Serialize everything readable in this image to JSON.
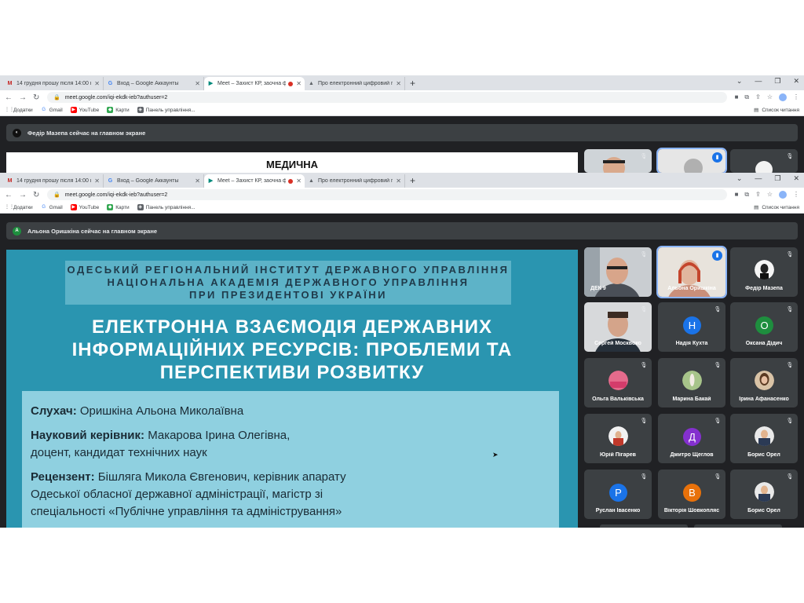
{
  "tabs": [
    {
      "title": "14 грудня прошу після 14:00 пі",
      "favicon_color": "#c5221f",
      "favicon_glyph": "M"
    },
    {
      "title": "Вход – Google Аккаунты",
      "favicon_color": "#4285f4",
      "favicon_glyph": "G"
    },
    {
      "title": "Meet – Захист КР, заочна ф",
      "favicon_color": "#00897b",
      "favicon_glyph": "▶"
    },
    {
      "title": "Про електронний цифровий пі",
      "favicon_color": "#5f6368",
      "favicon_glyph": "▲"
    }
  ],
  "url": "meet.google.com/iqi-ekdk-ieb?authuser=2",
  "bookmarks": [
    {
      "label": "Додатки",
      "icon": "apps-icon",
      "color": "#5f6368"
    },
    {
      "label": "Gmail",
      "icon": "gmail-icon",
      "color": "#4285f4"
    },
    {
      "label": "YouTube",
      "icon": "youtube-icon",
      "color": "#ff0000"
    },
    {
      "label": "Карти",
      "icon": "maps-icon",
      "color": "#34a853"
    },
    {
      "label": "Панель управління...",
      "icon": "panel-icon",
      "color": "#5f6368"
    }
  ],
  "reading_list": "Список читання",
  "back_layer": {
    "banner": "Федір Мазепа сейчас на главном экране",
    "slide_heading": "МЕДИЧНА"
  },
  "banner": {
    "text": "Альона Оришкіна сейчас на главном экране",
    "avatar_letter": "А",
    "avatar_color": "#1e8e3e"
  },
  "slide": {
    "institution": [
      "ОДЕСЬКИЙ РЕГІОНАЛЬНИЙ ІНСТИТУТ ДЕРЖАВНОГО УПРАВЛІННЯ",
      "НАЦІОНАЛЬНА АКАДЕМІЯ ДЕРЖАВНОГО УПРАВЛІННЯ",
      "ПРИ ПРЕЗИДЕНТОВІ УКРАЇНИ"
    ],
    "title": [
      "ЕЛЕКТРОННА ВЗАЄМОДІЯ ДЕРЖАВНИХ",
      "ІНФОРМАЦІЙНИХ РЕСУРСІВ: ПРОБЛЕМИ ТА",
      "ПЕРСПЕКТИВИ РОЗВИТКУ"
    ],
    "student_label": "Слухач:",
    "student": "Оришкіна Альона Миколаївна",
    "supervisor_label": "Науковий керівник:",
    "supervisor": "Макарова Ірина Олегівна,",
    "supervisor_title": "доцент, кандидат технічних наук",
    "reviewer_label": "Рецензент:",
    "reviewer": "Бішляга Микола Євгенович, керівник апарату",
    "reviewer_line2": "Одеської обласної державної адміністрації, магістр зі",
    "reviewer_line3": "спеціальності  «Публічне управління та адміністрування»"
  },
  "participants": [
    {
      "name": "ДЕК 9",
      "kind": "video",
      "mic": "muted"
    },
    {
      "name": "Альона Оришкіна",
      "kind": "video",
      "mic": "speaking"
    },
    {
      "name": "Федір Мазепа",
      "kind": "photo",
      "mic": "muted"
    },
    {
      "name": "Сергей Москвоко",
      "kind": "video",
      "mic": "muted"
    },
    {
      "name": "Надія Кухта",
      "kind": "initial",
      "letter": "Н",
      "color": "#1a73e8",
      "mic": "muted"
    },
    {
      "name": "Оксана Дідич",
      "kind": "initial",
      "letter": "О",
      "color": "#1e8e3e",
      "mic": "muted"
    },
    {
      "name": "Ольга Вальківська",
      "kind": "photo",
      "mic": "muted"
    },
    {
      "name": "Марина Бакай",
      "kind": "photo",
      "mic": "muted"
    },
    {
      "name": "Ірина Афанасенко",
      "kind": "photo",
      "mic": "muted"
    },
    {
      "name": "Юрій Пігарев",
      "kind": "photo",
      "mic": "muted"
    },
    {
      "name": "Дмитро Щеглов",
      "kind": "initial",
      "letter": "Д",
      "color": "#8430ce",
      "mic": "muted"
    },
    {
      "name": "Борис Орел",
      "kind": "photo",
      "mic": "muted"
    },
    {
      "name": "Руслан Івасенко",
      "kind": "initial",
      "letter": "Р",
      "color": "#1a73e8",
      "mic": "muted"
    },
    {
      "name": "Вікторія Шовкопляс",
      "kind": "initial",
      "letter": "В",
      "color": "#e8710a",
      "mic": "muted"
    },
    {
      "name": "Борис Орел",
      "kind": "photo",
      "mic": "muted"
    }
  ]
}
